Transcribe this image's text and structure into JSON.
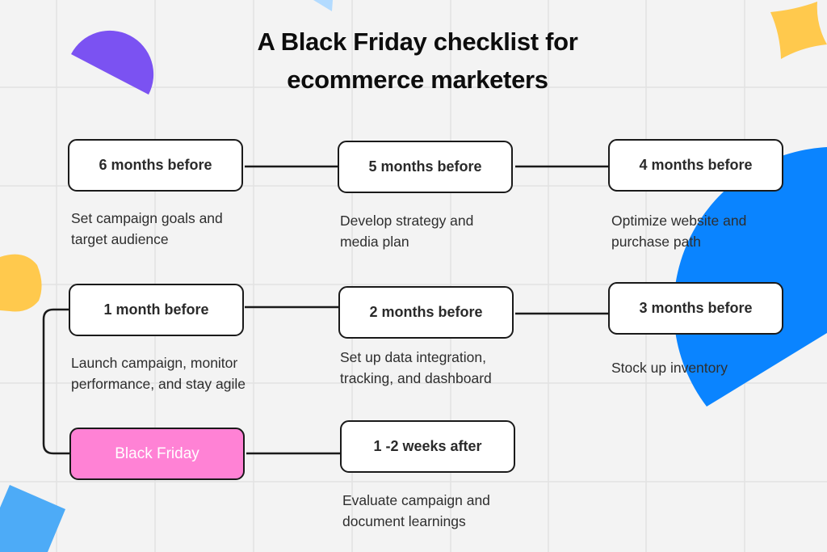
{
  "title": {
    "line1": "A Black Friday checklist for",
    "line2": "ecommerce marketers"
  },
  "colors": {
    "background": "#f3f3f3",
    "grid": "#e2e2e2",
    "box_border": "#1a1a1a",
    "highlight": "#ff82d5",
    "purple": "#7b52f2",
    "yellow": "#ffc94d",
    "blue": "#0a84ff",
    "light_blue": "#4dabf7",
    "pale_blue": "#b3dbff"
  },
  "steps": [
    {
      "id": "6-months",
      "label": "6 months before",
      "desc_line1": "Set campaign goals and",
      "desc_line2": "target audience"
    },
    {
      "id": "5-months",
      "label": "5 months before",
      "desc_line1": "Develop strategy and",
      "desc_line2": "media plan"
    },
    {
      "id": "4-months",
      "label": "4 months before",
      "desc_line1": "Optimize website and",
      "desc_line2": "purchase path"
    },
    {
      "id": "3-months",
      "label": "3 months before",
      "desc_line1": "Stock up inventory",
      "desc_line2": ""
    },
    {
      "id": "2-months",
      "label": "2 months before",
      "desc_line1": "Set up data integration,",
      "desc_line2": "tracking, and dashboard"
    },
    {
      "id": "1-month",
      "label": "1 month before",
      "desc_line1": "Launch campaign, monitor",
      "desc_line2": "performance, and stay agile"
    },
    {
      "id": "black-friday",
      "label": "Black Friday",
      "desc_line1": "",
      "desc_line2": ""
    },
    {
      "id": "1-2-weeks-after",
      "label": "1 -2 weeks after",
      "desc_line1": "Evaluate campaign and",
      "desc_line2": "document learnings"
    }
  ]
}
